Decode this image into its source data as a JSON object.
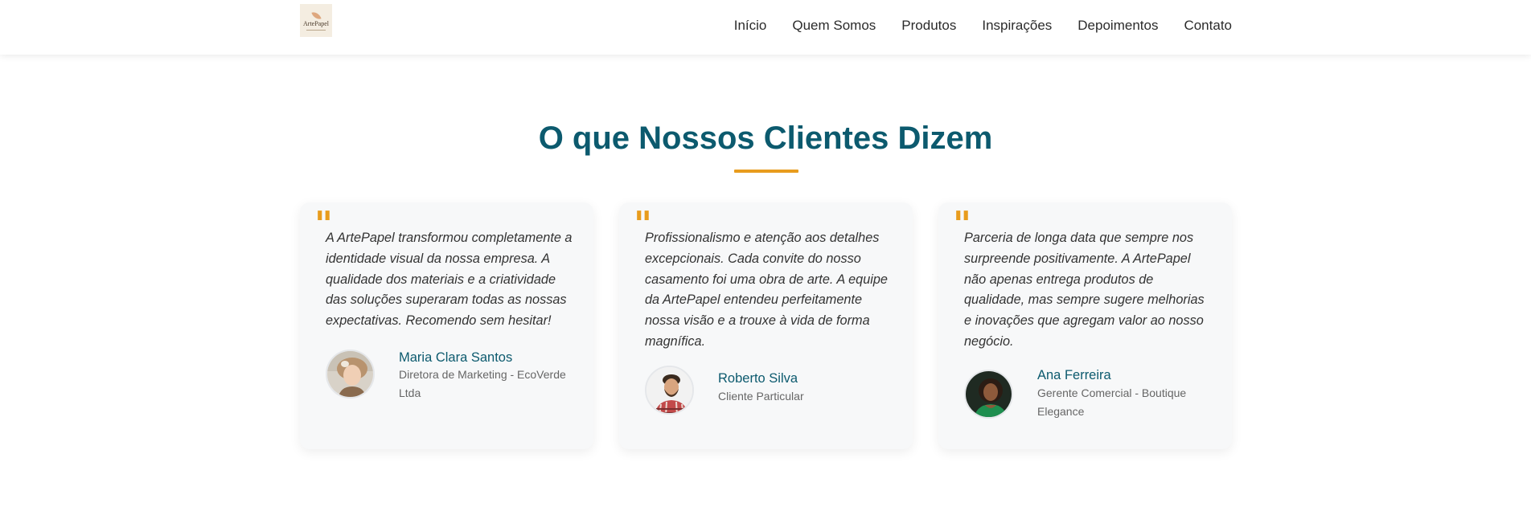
{
  "header": {
    "logo_text": "ArtePapel",
    "nav": [
      "Início",
      "Quem Somos",
      "Produtos",
      "Inspirações",
      "Depoimentos",
      "Contato"
    ]
  },
  "section": {
    "title": "O que Nossos Clientes Dizem"
  },
  "testimonials": [
    {
      "quote": "A ArtePapel transformou completamente a identidade visual da nossa empresa. A qualidade dos materiais e a criatividade das soluções superaram todas as nossas expectativas. Recomendo sem hesitar!",
      "name": "Maria Clara Santos",
      "role": "Diretora de Marketing - EcoVerde Ltda"
    },
    {
      "quote": "Profissionalismo e atenção aos detalhes excepcionais. Cada convite do nosso casamento foi uma obra de arte. A equipe da ArtePapel entendeu perfeitamente nossa visão e a trouxe à vida de forma magnífica.",
      "name": "Roberto Silva",
      "role": "Cliente Particular"
    },
    {
      "quote": "Parceria de longa data que sempre nos surpreende positivamente. A ArtePapel não apenas entrega produtos de qualidade, mas sempre sugere melhorias e inovações que agregam valor ao nosso negócio.",
      "name": "Ana Ferreira",
      "role": "Gerente Comercial - Boutique Elegance"
    }
  ],
  "colors": {
    "primary": "#0c5a6e",
    "accent": "#e89c1d",
    "card_bg": "#f7f8f9"
  },
  "icons": {
    "quote": "quote-mark-icon"
  }
}
